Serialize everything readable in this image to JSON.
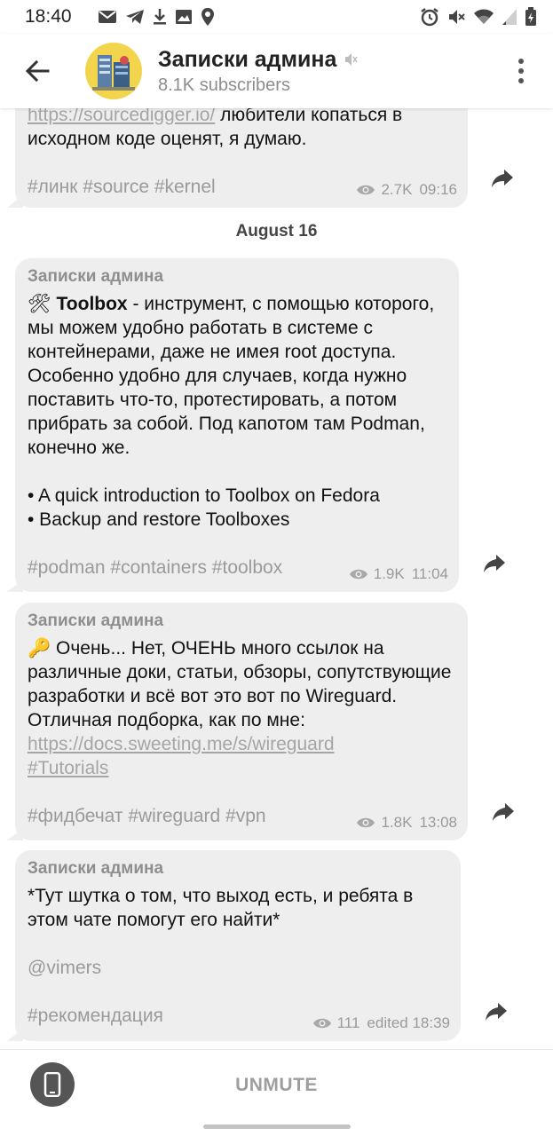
{
  "status_bar": {
    "time": "18:40",
    "left_icons": [
      "gmail-icon",
      "telegram-icon",
      "download-icon",
      "image-icon",
      "location-icon"
    ],
    "right_icons": [
      "alarm-icon",
      "mute-icon",
      "wifi-icon",
      "signal-icon",
      "battery-icon"
    ]
  },
  "header": {
    "title": "Записки админа",
    "subtitle": "8.1K subscribers",
    "muted_icon": "speaker-muted-icon"
  },
  "feed": {
    "date_separator": "August 16",
    "messages": [
      {
        "partial": true,
        "text_link": "https://sourcedigger.io/",
        "text_line1_rest": " любители копаться в",
        "text_line2": "исходном коде оценят, я думаю.",
        "tags": "#линк #source #kernel",
        "views": "2.7K",
        "time": "09:16"
      },
      {
        "author": "Записки админа",
        "emoji": "🛠",
        "bold": "Toolbox",
        "text": " - инструмент, с помощью которого, мы можем удобно работать в системе с контейнерами, даже не имея root доступа. Особенно удобно для случаев, когда нужно поставить что-то, протестировать, а потом прибрать за собой. Под капотом там Podman, конечно же.",
        "list": [
          "• A quick introduction to Toolbox on Fedora",
          "• Backup and restore Toolboxes"
        ],
        "tags": "#podman #containers #toolbox",
        "views": "1.9K",
        "time": "11:04"
      },
      {
        "author": "Записки админа",
        "emoji": "🔑",
        "text": " Очень... Нет, ОЧЕНЬ много ссылок на различные доки, статьи, обзоры, сопутствующие разработки и всё вот это вот по Wireguard. Отличная подборка, как по мне: ",
        "link": "https://docs.sweeting.me/s/wireguard",
        "link2": "#Tutorials",
        "tags": "#фидбечат #wireguard #vpn",
        "views": "1.8K",
        "time": "13:08"
      },
      {
        "author": "Записки админа",
        "text": "*Тут шутка о том, что выход есть, и ребята в этом чате помогут его найти*",
        "mention": "@vimers",
        "tags": "#рекомендация",
        "views": "111",
        "time": "edited 18:39"
      }
    ]
  },
  "bottom_bar": {
    "unmute_label": "UNMUTE",
    "left_button_icon": "phone-icon"
  },
  "colors": {
    "bubble": "#eeeeee",
    "avatar_bg": "#f3d54d",
    "secondary_text": "#9a9a9a"
  }
}
